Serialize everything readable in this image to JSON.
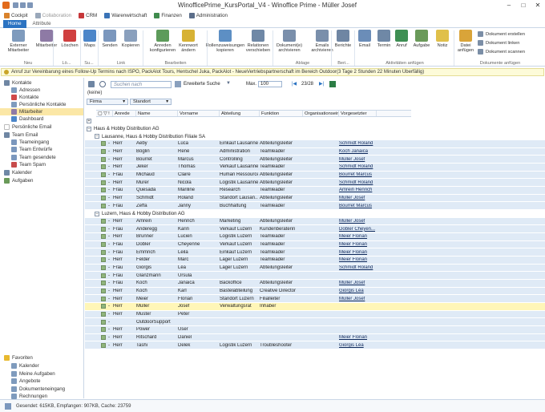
{
  "window": {
    "title": "WinofficePrime_KursPortal_V4 - Winoffice Prime - Müller Josef"
  },
  "appbar": [
    {
      "label": "Cockpit",
      "color": "#d9822b",
      "dim": false
    },
    {
      "label": "Collaboration",
      "color": "#9aa8ba",
      "dim": true
    },
    {
      "label": "CRM",
      "color": "#c6373a",
      "dim": false
    },
    {
      "label": "Warenwirtschaft",
      "color": "#3a73b7",
      "dim": false
    },
    {
      "label": "Finanzen",
      "color": "#3f8b4d",
      "dim": false
    },
    {
      "label": "Administration",
      "color": "#5b6e8a",
      "dim": false
    }
  ],
  "tabs": [
    "Home",
    "Attribute"
  ],
  "ribbon": {
    "buttons": [
      {
        "label": "Externer Mitarbeiter",
        "icon": "user-add-icon",
        "color": "#7f9bbd"
      },
      {
        "label": "Mitarbeiter",
        "icon": "employee-icon",
        "color": "#8e7aa5"
      },
      {
        "label": "Löschen",
        "icon": "delete-icon",
        "color": "#d04040"
      },
      {
        "label": "Maps",
        "icon": "map-pin-icon",
        "color": "#4c86c9"
      },
      {
        "label": "Senden",
        "icon": "send-icon",
        "color": "#7b97bd"
      },
      {
        "label": "Kopieren",
        "icon": "copy-icon",
        "color": "#8aa0bd"
      },
      {
        "label": "Anreden konfigurieren",
        "icon": "salutation-icon",
        "color": "#5d9b5a"
      },
      {
        "label": "Kennwort ändern",
        "icon": "key-icon",
        "color": "#d7b234"
      },
      {
        "label": "Rollenzuweisungen kopieren",
        "icon": "roles-icon",
        "color": "#5d8fc4"
      },
      {
        "label": "Relationen verschieben",
        "icon": "relations-icon",
        "color": "#6f88a6"
      },
      {
        "label": "Dokument(e) archivieren",
        "icon": "archive-doc-icon",
        "color": "#7a8fab"
      },
      {
        "label": "Emails archivieren",
        "icon": "archive-mail-icon",
        "color": "#7a8fab"
      },
      {
        "label": "Berichte",
        "icon": "report-icon",
        "color": "#6f86a3"
      },
      {
        "label": "Email",
        "icon": "email-icon",
        "color": "#6b8db8"
      },
      {
        "label": "Termin",
        "icon": "calendar-icon",
        "color": "#6f88a6"
      },
      {
        "label": "Anruf",
        "icon": "phone-icon",
        "color": "#3e8f53"
      },
      {
        "label": "Aufgabe",
        "icon": "task-icon",
        "color": "#6a9a59"
      },
      {
        "label": "Notiz",
        "icon": "note-icon",
        "color": "#e0c04a"
      },
      {
        "label": "Datei anfügen",
        "icon": "attach-icon",
        "color": "#d9a439"
      }
    ],
    "small": [
      "Dokument erstellen",
      "Dokument linken",
      "Dokument scannen"
    ],
    "groups": [
      "Neu",
      "Lö...",
      "Su...",
      "Link",
      "Bearbeiten",
      "Ablage",
      "Beri...",
      "Aktivitäten anfügen",
      "Dokumente anfügen"
    ]
  },
  "notice": "Anruf zur Vereinbarung eines Follow-Up Termins nach ISPO, PackAlot Tours, Hentschel Juka, PackAlot - NeueVertriebspartnerschaft im Bereich Outdoor(3 Tage 2 Stunden 22 Minuten Überfällig)",
  "sidebar": {
    "items": [
      {
        "label": "Kontakte",
        "lvl": 0,
        "color": "#6f86a3"
      },
      {
        "label": "Adressen",
        "lvl": 1,
        "color": "#7f9bbd"
      },
      {
        "label": "Kontakte",
        "lvl": 1,
        "color": "#d04848"
      },
      {
        "label": "Persönliche Kontakte",
        "lvl": 1,
        "color": "#7f9bbd"
      },
      {
        "label": "Mitarbeiter",
        "lvl": 1,
        "color": "#8e7aa5",
        "sel": true
      },
      {
        "label": "Dashboard",
        "lvl": 1,
        "color": "#4c86c9"
      },
      {
        "label": "Persönliche Email",
        "lvl": 0,
        "color": "#ffffff"
      },
      {
        "label": "Team Email",
        "lvl": 0,
        "color": "#6f86a3"
      },
      {
        "label": "Teameingang",
        "lvl": 1,
        "color": "#7b97bd"
      },
      {
        "label": "Team Entwürfe",
        "lvl": 1,
        "color": "#7b97bd"
      },
      {
        "label": "Team gesendete",
        "lvl": 1,
        "color": "#7b97bd"
      },
      {
        "label": "Team Spam",
        "lvl": 1,
        "color": "#c74b4b"
      },
      {
        "label": "Kalender",
        "lvl": 0,
        "color": "#6f88a6"
      },
      {
        "label": "Aufgaben",
        "lvl": 0,
        "color": "#6a9a59"
      }
    ],
    "favorites_title": "Favoriten",
    "favorites": [
      "Kalender",
      "Meine Aufgaben",
      "Angebote",
      "Dokumenteneingang",
      "Rechnungen"
    ]
  },
  "toolbar": {
    "search_placeholder": "Suchen nach",
    "extended_search": "Erweiterte Suche",
    "max_label": "Max.",
    "max_value": "100",
    "pager": "23/28"
  },
  "grouping": {
    "placeholder": "(keine)",
    "columns": [
      "Firma",
      "Standort"
    ]
  },
  "columns": [
    "Anrede",
    "Name",
    "Vorname",
    "Abteilung",
    "Funktion",
    "Organisationsein...",
    "Vorgesetzter"
  ],
  "groups": [
    {
      "company": "Haus & Hobby Distribution AG",
      "sublocs": [
        {
          "loc": "Lausanne, Haus & Hobby Distribution Filiale SA",
          "rows": [
            [
              "Herr",
              "Aeby",
              "Lüca",
              "Einkauf Lausanne",
              "Abteilungsleiter",
              "",
              "Schmidt Roland"
            ],
            [
              "Herr",
              "Böglin",
              "René",
              "Administration",
              "Teamleader",
              "",
              "Koch Janaica"
            ],
            [
              "Herr",
              "Bourret",
              "Marcus",
              "Controlling",
              "Abteilungsleiter",
              "",
              "Müller Josef"
            ],
            [
              "Herr",
              "Jeker",
              "Thomas",
              "Verkauf Lausanne",
              "Teamleader",
              "",
              "Schmidt Roland"
            ],
            [
              "Frau",
              "Michaud",
              "Claire",
              "Human Ressource",
              "Abteilungsleiter",
              "",
              "Bourret Marcus"
            ],
            [
              "Herr",
              "Murer",
              "Nicola",
              "Logistik Lausanne",
              "Abteilungsleiter",
              "",
              "Schmidt Roland"
            ],
            [
              "Frau",
              "Quesada",
              "Mariline",
              "Research",
              "Teamleader",
              "",
              "Amrein Henrich"
            ],
            [
              "Herr",
              "Schmidt",
              "Roland",
              "Standort Lausan...",
              "Abteilungsleiter",
              "",
              "Müller Josef"
            ],
            [
              "Frau",
              "Zeffa",
              "Janny",
              "Buchhaltung",
              "Teamleader",
              "",
              "Bourret Marcus"
            ]
          ]
        },
        {
          "loc": "Luzern, Haus & Hobby Distribution AG",
          "rows": [
            [
              "Herr",
              "Amrein",
              "Henrich",
              "Marketing",
              "Abteilungsleiter",
              "",
              "Müller Josef"
            ],
            [
              "Frau",
              "Anderegg",
              "Karin",
              "Verkauf Luzern",
              "Kundenberaterin",
              "",
              "Dobler Cheyen..."
            ],
            [
              "Herr",
              "Brunner",
              "Lucien",
              "Logistik Luzern",
              "Teamleader",
              "",
              "Meier Florian"
            ],
            [
              "Frau",
              "Dobler",
              "Cheyenne",
              "Verkauf Luzern",
              "Teamleader",
              "",
              "Meier Florian"
            ],
            [
              "Frau",
              "Emmrich",
              "Leila",
              "Einkauf Luzern",
              "Teamleader",
              "",
              "Meier Florian"
            ],
            [
              "Herr",
              "Felder",
              "Marc",
              "Lager Luzern",
              "Teamleader",
              "",
              "Meier Florian"
            ],
            [
              "Frau",
              "Giorgis",
              "Léa",
              "Lager Luzern",
              "Abteilungsleiter",
              "",
              "Schmidt Roland"
            ],
            [
              "Frau",
              "Glanzmann",
              "Ursula",
              "",
              "",
              "",
              ""
            ],
            [
              "Frau",
              "Koch",
              "Janaica",
              "Backoffice",
              "Abteilungsleiter",
              "",
              "Müller Josef"
            ],
            [
              "Herr",
              "Koch",
              "Karl",
              "Bastelabteilung",
              "Creative Director",
              "",
              "Giorgis Léa"
            ],
            [
              "Herr",
              "Meier",
              "Florian",
              "Standort Luzern",
              "Filialleiter",
              "",
              "Müller Josef"
            ],
            [
              "Herr",
              "Müller",
              "Josef",
              "Verwaltungsrat",
              "Inhaber",
              "",
              "",
              true
            ],
            [
              "Herr",
              "Muster",
              "Peter",
              "",
              "",
              "",
              ""
            ],
            [
              "",
              "OutdoorSupport",
              "",
              "",
              "",
              "",
              ""
            ],
            [
              "Herr",
              "Power",
              "User",
              "",
              "",
              "",
              ""
            ],
            [
              "Herr",
              "Ritschard",
              "Daniel",
              "",
              "",
              "",
              "Meier Florian"
            ],
            [
              "Herr",
              "Tashi",
              "Delek",
              "Logistik Luzern",
              "Troubleshooter",
              "",
              "Giorgis Léa"
            ]
          ]
        }
      ]
    }
  ],
  "status": "Gesendet: 615KB, Empfangen: 907KB, Cache: 23759"
}
